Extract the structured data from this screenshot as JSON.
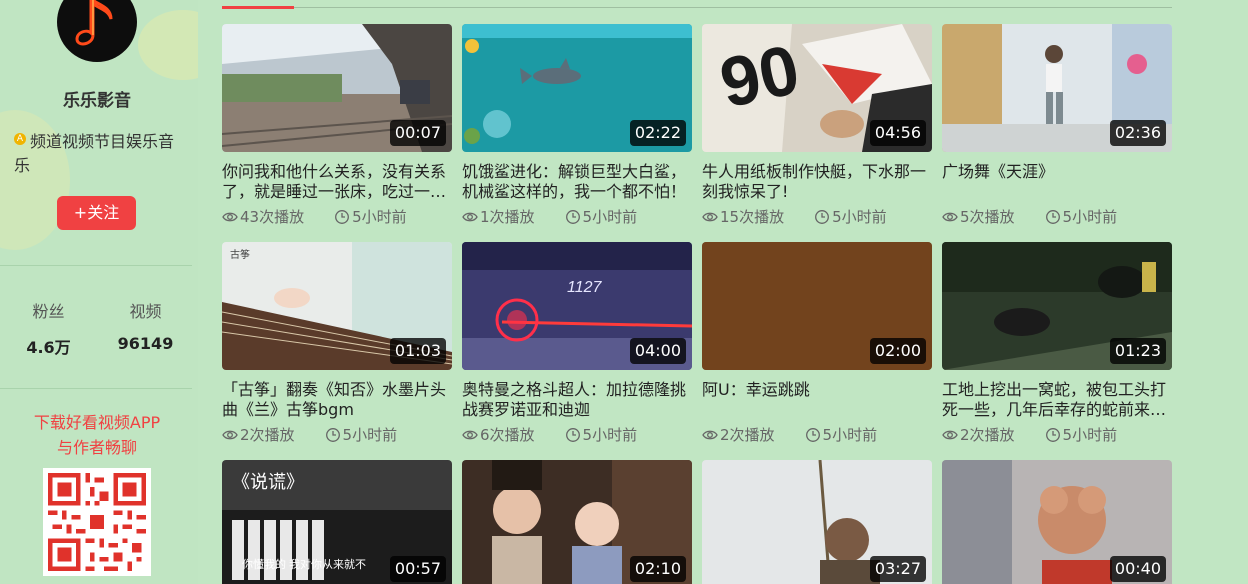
{
  "sidebar": {
    "channel_name": "乐乐影音",
    "description": "频道视频节目娱乐音乐",
    "follow_label": "+关注",
    "stats": [
      {
        "label": "粉丝",
        "value": "4.6万"
      },
      {
        "label": "视频",
        "value": "96149"
      }
    ],
    "download_line1": "下载好看视频APP",
    "download_line2": "与作者畅聊"
  },
  "videos": [
    {
      "title": "你问我和他什么关系，没有关系了，就是睡过一张床，吃过一个...",
      "duration": "00:07",
      "views": "43次播放",
      "time": "5小时前"
    },
    {
      "title": "饥饿鲨进化：解锁巨型大白鲨，机械鲨这样的，我一个都不怕！",
      "duration": "02:22",
      "views": "1次播放",
      "time": "5小时前"
    },
    {
      "title": "牛人用纸板制作快艇，下水那一刻我惊呆了!",
      "duration": "04:56",
      "views": "15次播放",
      "time": "5小时前"
    },
    {
      "title": "广场舞《天涯》",
      "duration": "02:36",
      "views": "5次播放",
      "time": "5小时前"
    },
    {
      "title": "「古筝」翻奏《知否》水墨片头曲《兰》古筝bgm",
      "duration": "01:03",
      "views": "2次播放",
      "time": "5小时前"
    },
    {
      "title": "奥特曼之格斗超人：加拉德隆挑战赛罗诺亚和迪迦",
      "duration": "04:00",
      "views": "6次播放",
      "time": "5小时前"
    },
    {
      "title": "阿U：幸运跳跳",
      "duration": "02:00",
      "views": "2次播放",
      "time": "5小时前"
    },
    {
      "title": "工地上挖出一窝蛇，被包工头打死一些，几年后幸存的蛇前来复仇",
      "duration": "01:23",
      "views": "2次播放",
      "time": "5小时前"
    },
    {
      "title": "",
      "duration": "00:57",
      "views": "",
      "time": ""
    },
    {
      "title": "",
      "duration": "02:10",
      "views": "",
      "time": ""
    },
    {
      "title": "",
      "duration": "03:27",
      "views": "",
      "time": ""
    },
    {
      "title": "",
      "duration": "00:40",
      "views": "",
      "time": ""
    }
  ],
  "thumb_texts": {
    "lie": "《说谎》",
    "lie_sub": "你懂我的 我对你从来就不",
    "guzheng": "古筝",
    "game_score": "1127"
  },
  "icons": {
    "views": "eye-icon",
    "time": "clock-icon",
    "cert": "certified-badge-icon"
  },
  "colors": {
    "accent": "#f04142",
    "background": "#c1e6c3"
  }
}
